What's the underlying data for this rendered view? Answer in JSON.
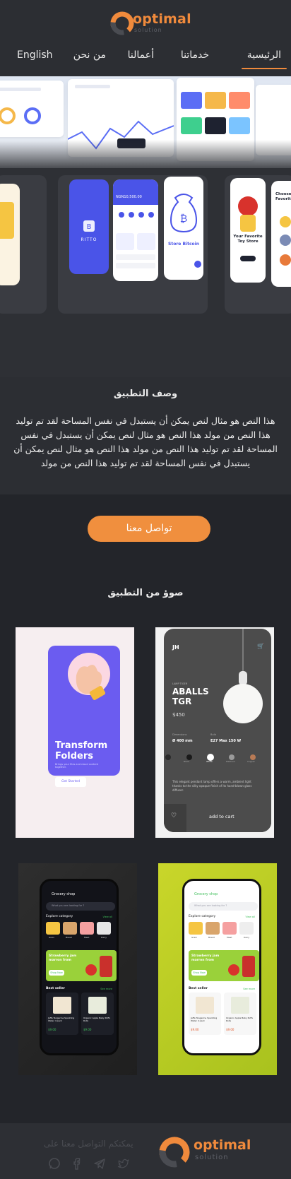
{
  "brand": {
    "name": "optimal",
    "tagline": "solution",
    "accent": "#f08a3c"
  },
  "nav": {
    "items": [
      {
        "label": "الرئيسية",
        "active": true
      },
      {
        "label": "خدماتنا"
      },
      {
        "label": "أعمالنا"
      },
      {
        "label": "من نحن"
      },
      {
        "label": "English"
      }
    ]
  },
  "hero": {
    "dashboard": {
      "balance": "NGN10,500.00",
      "card_brand": "RITTO"
    },
    "cards": [
      {
        "title": "Store Bitcoin"
      },
      {
        "title": "Your Favorite Toy Store"
      },
      {
        "title": "Choose Favorite"
      }
    ]
  },
  "description": {
    "title": "وصف التطبيق",
    "body": "هذا النص هو مثال لنص يمكن أن يستبدل في نفس المساحة لقد تم توليد هذا النص من مولد هذا النص هو مثال لنص يمكن أن يستبدل في نفس المساحة لقد تم توليد هذا النص من مولد هذا النص هو مثال لنص يمكن أن يستبدل في نفس المساحة لقد تم توليد هذا النص من مولد"
  },
  "cta": {
    "label": "تواصل معنا"
  },
  "screens": {
    "title": "صوؤ من التطبيق",
    "folders": {
      "heading": "Transform Folders",
      "sub": "Brings your files and cloud content together.",
      "button": "Get Started"
    },
    "lamp": {
      "brand": "JH",
      "label": "LAMP TIGER",
      "title": "ABALLS TGR",
      "price": "$450",
      "dim_label": "Dimensions",
      "dim_value": "Ø 400 mm",
      "bulb_label": "Bulb",
      "bulb_value": "E27 Max 150 W",
      "colors": [
        "Black",
        "White",
        "Platinum",
        "Copper"
      ],
      "desc": "This elegant pendant lamp offers a warm, ambient light thanks to the silky opaque finish of its hand-blown glass diffuser.",
      "cta": "add to cart"
    },
    "grocery": {
      "title": "Grocery shop",
      "search": "What you are looking for ?",
      "category_label": "Explore category",
      "view_all": "View all",
      "categories": [
        "Grain",
        "Bread",
        "Meat",
        "Dairy"
      ],
      "promo": "Strawberry jam marron from",
      "promo_button": "Shop Now",
      "best_label": "Best seller",
      "see_more": "See more",
      "products": [
        {
          "name": "Jaffa Tangerine Sparkling Water 4 pack",
          "price": "$9.00",
          "old": "$40"
        },
        {
          "name": "Organic Apple Baby Puffs Rolls",
          "price": "$9.00"
        }
      ]
    }
  },
  "footer": {
    "contact": "يمكنكم التواصل معنا على",
    "icons": [
      "whatsapp-icon",
      "facebook-icon",
      "telegram-icon",
      "twitter-icon"
    ]
  }
}
